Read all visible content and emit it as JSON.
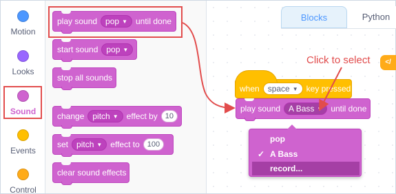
{
  "categories": [
    {
      "label": "Motion",
      "color": "#4c97ff",
      "selected": false
    },
    {
      "label": "Looks",
      "color": "#9966ff",
      "selected": false
    },
    {
      "label": "Sound",
      "color": "#cf63cf",
      "selected": true
    },
    {
      "label": "Events",
      "color": "#ffbf00",
      "selected": false
    },
    {
      "label": "Control",
      "color": "#ffab19",
      "selected": false
    }
  ],
  "palette": {
    "play_until_done": {
      "text1": "play sound",
      "dropdown": "pop",
      "text2": "until done"
    },
    "start_sound": {
      "text1": "start sound",
      "dropdown": "pop"
    },
    "stop_all": {
      "text1": "stop all sounds"
    },
    "change_effect": {
      "text1": "change",
      "dropdown": "pitch",
      "text2": "effect by",
      "value": "10"
    },
    "set_effect": {
      "text1": "set",
      "dropdown": "pitch",
      "text2": "effect to",
      "value": "100"
    },
    "clear_effects": {
      "text1": "clear sound effects"
    }
  },
  "tabs": {
    "blocks": "Blocks",
    "python": "Python"
  },
  "ext_label": "</",
  "workspace": {
    "hat": {
      "text1": "when",
      "dropdown": "space",
      "text2": "key pressed"
    },
    "play_block": {
      "text1": "play sound",
      "dropdown": "A Bass",
      "text2": "until done"
    }
  },
  "menu": {
    "options": [
      {
        "label": "pop",
        "checked": false,
        "hover": false
      },
      {
        "label": "A Bass",
        "checked": true,
        "hover": false
      },
      {
        "label": "record...",
        "checked": false,
        "hover": true
      }
    ],
    "check_mark": "✓"
  },
  "annotation": "Click to select",
  "colors": {
    "sound": "#cf63cf",
    "events": "#ffbf00",
    "highlight": "#e24c4c",
    "tab_accent": "#4c97ff"
  }
}
